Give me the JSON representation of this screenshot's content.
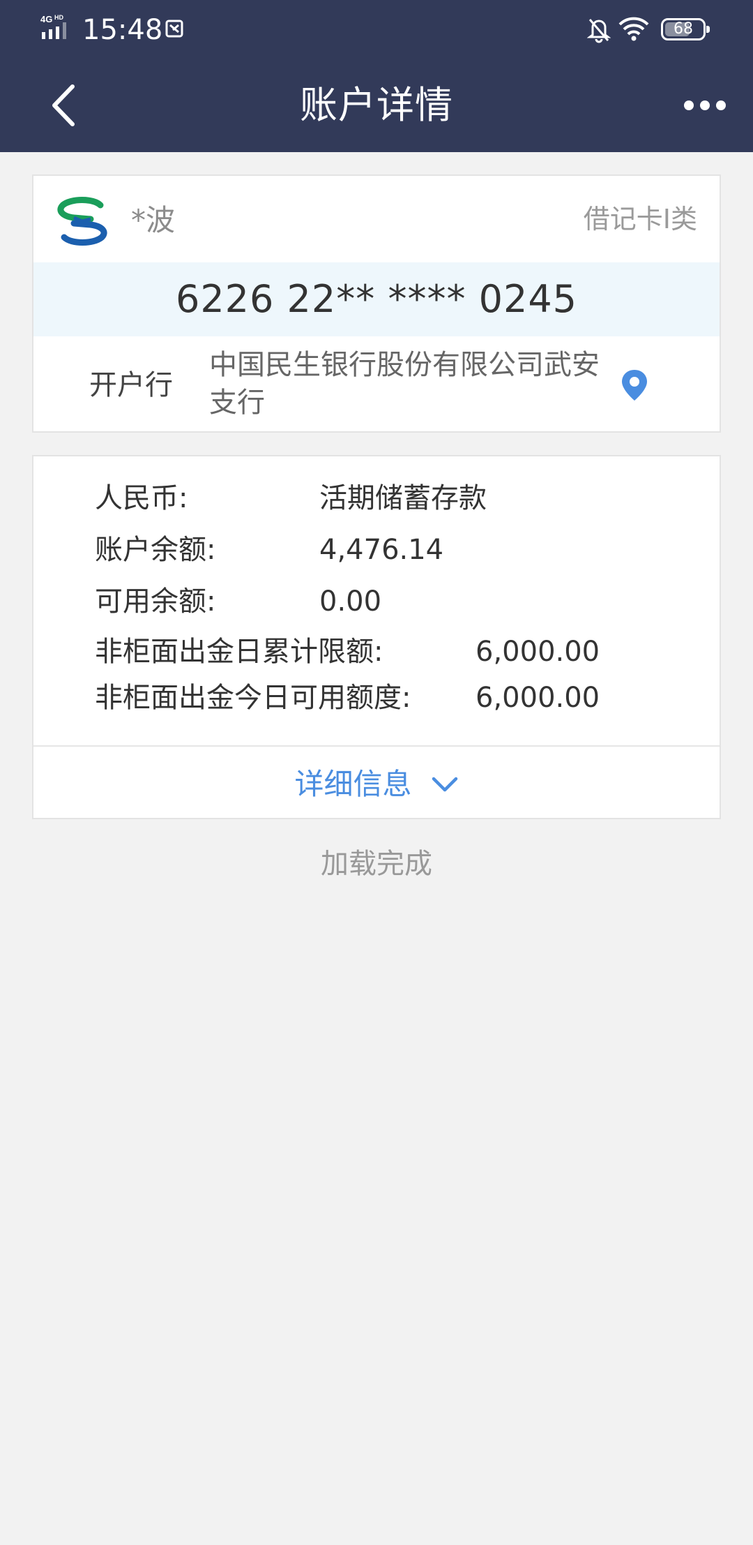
{
  "status_bar": {
    "network": "4G HD",
    "time": "15:48",
    "battery": "68",
    "battery_level_percent": 68
  },
  "nav": {
    "title": "账户详情"
  },
  "account_card": {
    "holder_name": "*波",
    "card_type": "借记卡I类",
    "card_number": "6226 22** **** 0245",
    "bank_label": "开户行",
    "bank_name": "中国民生银行股份有限公司武安支行"
  },
  "balance_card": {
    "rows": [
      {
        "label": "人民币:",
        "value": "活期储蓄存款"
      },
      {
        "label": "账户余额:",
        "value": "4,476.14"
      },
      {
        "label": "可用余额:",
        "value": "0.00"
      },
      {
        "label": "非柜面出金日累计限额:",
        "value": "6,000.00"
      },
      {
        "label": "非柜面出金今日可用额度:",
        "value": "6,000.00"
      }
    ],
    "detail_label": "详细信息"
  },
  "footer": {
    "load_status": "加载完成"
  },
  "colors": {
    "header": "#323a59",
    "accent": "#4a8de0",
    "highlight_band": "#eef7fc"
  },
  "icons": [
    "signal-icon",
    "screenshot-icon",
    "mute-bell-icon",
    "wifi-icon",
    "battery-icon",
    "back-arrow-icon",
    "more-icon",
    "bank-logo-icon",
    "location-pin-icon",
    "chevron-down-icon"
  ]
}
